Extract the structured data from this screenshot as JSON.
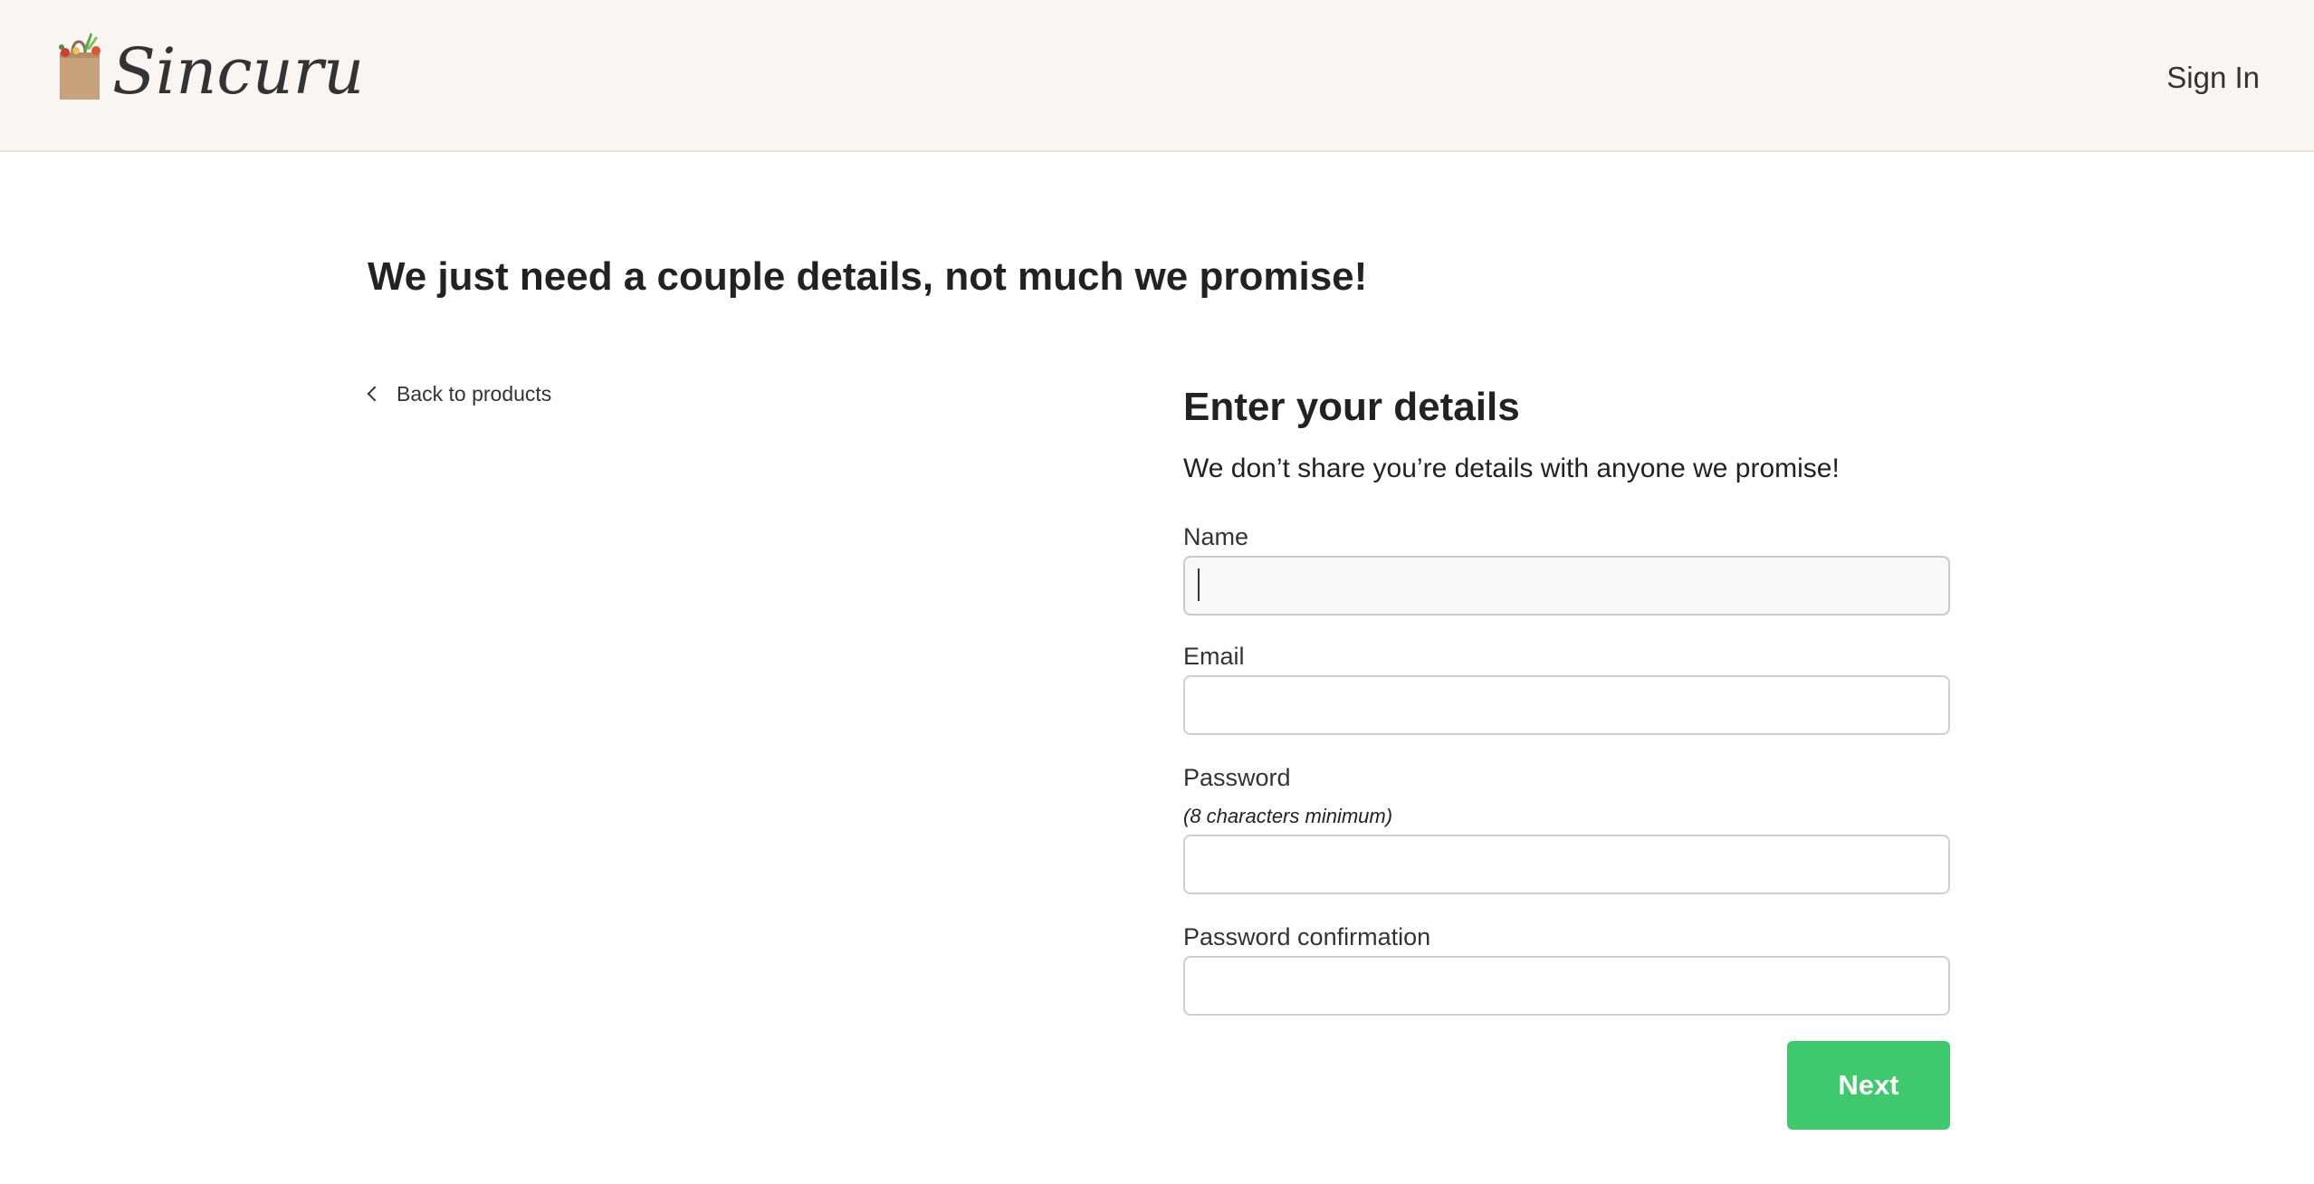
{
  "header": {
    "brand": "Sincuru",
    "logo_icon": "grocery-bag-icon",
    "sign_in_label": "Sign In"
  },
  "page": {
    "title": "We just need a couple details, not much we promise!",
    "back_link_label": "Back to products",
    "back_icon": "chevron-left-icon"
  },
  "form": {
    "heading": "Enter your details",
    "subheading": "We don’t share you’re details with anyone we promise!",
    "fields": {
      "name": {
        "label": "Name",
        "value": ""
      },
      "email": {
        "label": "Email",
        "value": ""
      },
      "password": {
        "label": "Password",
        "hint": "(8 characters minimum)",
        "value": ""
      },
      "password_confirmation": {
        "label": "Password confirmation",
        "value": ""
      }
    },
    "submit_label": "Next"
  },
  "colors": {
    "header_bg": "#f8f5f2",
    "accent_green": "#3ec96c",
    "text": "#222222",
    "input_border": "#cfcfcf"
  }
}
